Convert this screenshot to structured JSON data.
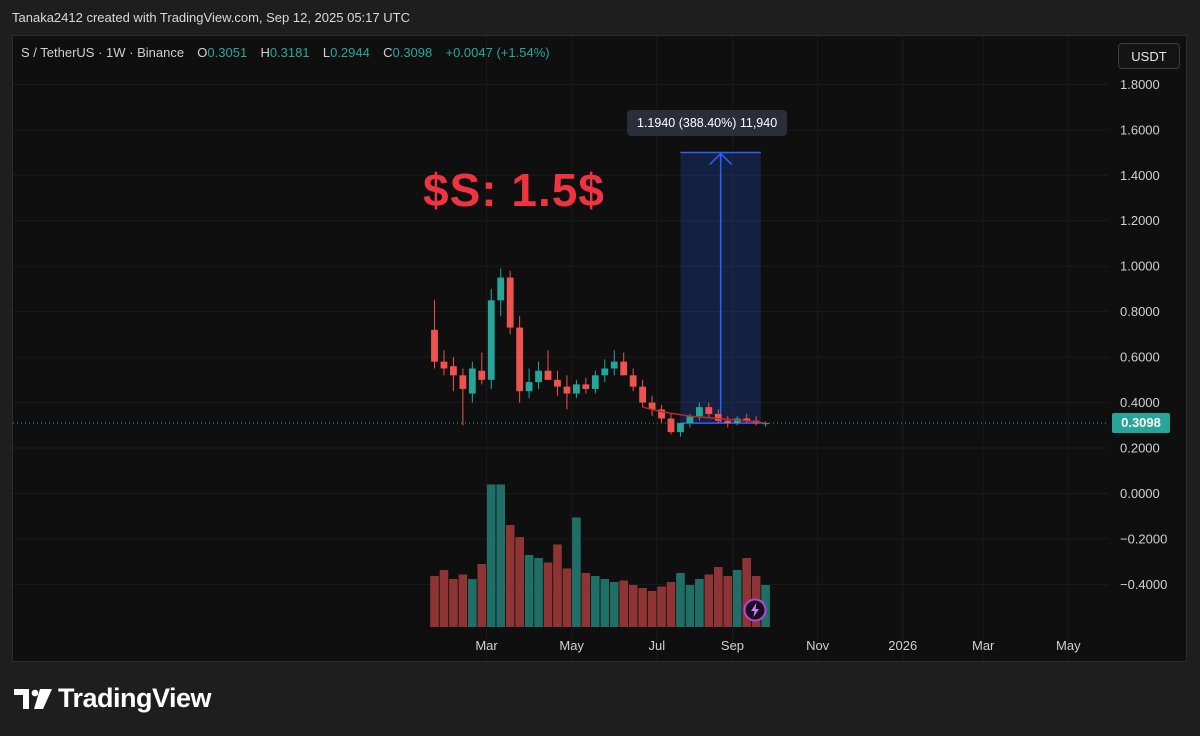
{
  "header": {
    "attribution": "Tanaka2412 created with TradingView.com, Sep 12, 2025 05:17 UTC"
  },
  "legend": {
    "symbol": "S / TetherUS · 1W · Binance",
    "o_label": "O",
    "o_value": "0.3051",
    "h_label": "H",
    "h_value": "0.3181",
    "l_label": "L",
    "l_value": "0.2944",
    "c_label": "C",
    "c_value": "0.3098",
    "change": "+0.0047 (+1.54%)"
  },
  "currency_button": "USDT",
  "annotation_title": "$S: 1.5$",
  "measure_tooltip": "1.1940 (388.40%) 11,940",
  "price_badge": "0.3098",
  "footer_brand": "TradingView",
  "colors": {
    "up": "#26a69a",
    "down": "#ef5350",
    "up_volume": "#1f6f67",
    "down_volume": "#8f3434",
    "ma_line": "#c62828",
    "measure": "#2962ff",
    "title": "#ef3340"
  },
  "chart_data": {
    "type": "candlestick",
    "y_ticks": [
      "1.8000",
      "1.6000",
      "1.4000",
      "1.2000",
      "1.0000",
      "0.8000",
      "0.6000",
      "0.4000",
      "0.2000",
      "0.0000",
      "−0.2000",
      "−0.4000"
    ],
    "x_ticks": [
      {
        "label": "Mar",
        "week": 5.5
      },
      {
        "label": "May",
        "week": 14.5
      },
      {
        "label": "Jul",
        "week": 23.5
      },
      {
        "label": "Sep",
        "week": 31.5
      },
      {
        "label": "Nov",
        "week": 40.5
      },
      {
        "label": "2026",
        "week": 49.5
      },
      {
        "label": "Mar",
        "week": 58
      },
      {
        "label": "May",
        "week": 67
      }
    ],
    "ylim": [
      -0.5,
      1.85
    ],
    "last_price": 0.3098,
    "candles": [
      {
        "o": 0.72,
        "h": 0.85,
        "l": 0.55,
        "c": 0.58
      },
      {
        "o": 0.58,
        "h": 0.63,
        "l": 0.52,
        "c": 0.55
      },
      {
        "o": 0.56,
        "h": 0.6,
        "l": 0.45,
        "c": 0.52
      },
      {
        "o": 0.52,
        "h": 0.55,
        "l": 0.3,
        "c": 0.46
      },
      {
        "o": 0.44,
        "h": 0.58,
        "l": 0.4,
        "c": 0.55
      },
      {
        "o": 0.54,
        "h": 0.62,
        "l": 0.48,
        "c": 0.5
      },
      {
        "o": 0.5,
        "h": 0.9,
        "l": 0.46,
        "c": 0.85
      },
      {
        "o": 0.85,
        "h": 0.99,
        "l": 0.78,
        "c": 0.95
      },
      {
        "o": 0.95,
        "h": 0.98,
        "l": 0.7,
        "c": 0.73
      },
      {
        "o": 0.73,
        "h": 0.78,
        "l": 0.4,
        "c": 0.45
      },
      {
        "o": 0.45,
        "h": 0.55,
        "l": 0.42,
        "c": 0.49
      },
      {
        "o": 0.49,
        "h": 0.58,
        "l": 0.46,
        "c": 0.54
      },
      {
        "o": 0.54,
        "h": 0.63,
        "l": 0.5,
        "c": 0.5
      },
      {
        "o": 0.5,
        "h": 0.54,
        "l": 0.43,
        "c": 0.47
      },
      {
        "o": 0.47,
        "h": 0.52,
        "l": 0.37,
        "c": 0.44
      },
      {
        "o": 0.44,
        "h": 0.5,
        "l": 0.42,
        "c": 0.48
      },
      {
        "o": 0.48,
        "h": 0.51,
        "l": 0.44,
        "c": 0.46
      },
      {
        "o": 0.46,
        "h": 0.54,
        "l": 0.44,
        "c": 0.52
      },
      {
        "o": 0.52,
        "h": 0.59,
        "l": 0.49,
        "c": 0.55
      },
      {
        "o": 0.55,
        "h": 0.63,
        "l": 0.52,
        "c": 0.58
      },
      {
        "o": 0.58,
        "h": 0.62,
        "l": 0.52,
        "c": 0.52
      },
      {
        "o": 0.52,
        "h": 0.55,
        "l": 0.45,
        "c": 0.47
      },
      {
        "o": 0.47,
        "h": 0.5,
        "l": 0.38,
        "c": 0.4
      },
      {
        "o": 0.4,
        "h": 0.43,
        "l": 0.34,
        "c": 0.37
      },
      {
        "o": 0.37,
        "h": 0.39,
        "l": 0.31,
        "c": 0.33
      },
      {
        "o": 0.33,
        "h": 0.35,
        "l": 0.26,
        "c": 0.27
      },
      {
        "o": 0.27,
        "h": 0.31,
        "l": 0.25,
        "c": 0.31
      },
      {
        "o": 0.31,
        "h": 0.35,
        "l": 0.29,
        "c": 0.34
      },
      {
        "o": 0.34,
        "h": 0.4,
        "l": 0.32,
        "c": 0.38
      },
      {
        "o": 0.38,
        "h": 0.4,
        "l": 0.33,
        "c": 0.35
      },
      {
        "o": 0.35,
        "h": 0.37,
        "l": 0.31,
        "c": 0.32
      },
      {
        "o": 0.32,
        "h": 0.34,
        "l": 0.29,
        "c": 0.31
      },
      {
        "o": 0.31,
        "h": 0.34,
        "l": 0.3,
        "c": 0.33
      },
      {
        "o": 0.33,
        "h": 0.35,
        "l": 0.31,
        "c": 0.32
      },
      {
        "o": 0.32,
        "h": 0.34,
        "l": 0.3,
        "c": 0.31
      },
      {
        "o": 0.305,
        "h": 0.318,
        "l": 0.294,
        "c": 0.3098
      }
    ],
    "volumes": [
      0.34,
      0.38,
      0.32,
      0.35,
      0.32,
      0.42,
      0.95,
      0.95,
      0.68,
      0.6,
      0.48,
      0.46,
      0.43,
      0.55,
      0.39,
      0.73,
      0.36,
      0.34,
      0.32,
      0.3,
      0.31,
      0.28,
      0.26,
      0.24,
      0.27,
      0.3,
      0.36,
      0.28,
      0.32,
      0.35,
      0.4,
      0.34,
      0.38,
      0.46,
      0.34,
      0.28
    ],
    "moving_average": [
      {
        "week": 22,
        "value": 0.38
      },
      {
        "week": 24,
        "value": 0.36
      },
      {
        "week": 27,
        "value": 0.34
      },
      {
        "week": 30,
        "value": 0.33
      },
      {
        "week": 33,
        "value": 0.32
      },
      {
        "week": 35,
        "value": 0.31
      }
    ],
    "measure": {
      "from_week": 26,
      "to_week": 34.5,
      "from_price": 0.3098,
      "to_price": 1.5,
      "label": "1.1940 (388.40%) 11,940"
    }
  }
}
